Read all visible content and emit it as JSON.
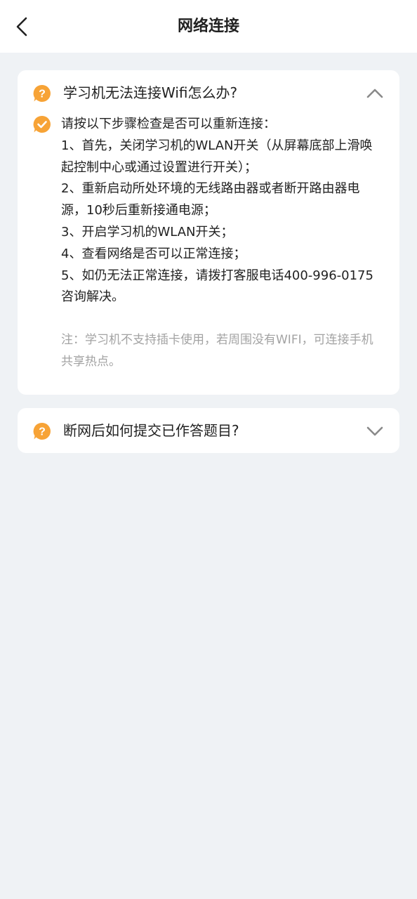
{
  "header": {
    "title": "网络连接"
  },
  "faq": [
    {
      "question": "学习机无法连接Wifi怎么办?",
      "expanded": true,
      "answer_lines": [
        "请按以下步骤检查是否可以重新连接：",
        "1、首先，关闭学习机的WLAN开关（从屏幕底部上滑唤起控制中心或通过设置进行开关）；",
        "2、重新启动所处环境的无线路由器或者断开路由器电源，10秒后重新接通电源；",
        "3、开启学习机的WLAN开关；",
        "4、查看网络是否可以正常连接；",
        "5、如仍无法正常连接，请拨打客服电话400-996-0175咨询解决。"
      ],
      "note": "注：学习机不支持插卡使用，若周围没有WIFI，可连接手机共享热点。"
    },
    {
      "question": "断网后如何提交已作答题目?",
      "expanded": false
    }
  ],
  "colors": {
    "accent": "#f7a336",
    "background": "#eff2f5",
    "card": "#ffffff",
    "note_text": "#a3a3a3",
    "chevron": "#8a8a8a"
  },
  "icons": {
    "back": "back-arrow-icon",
    "question": "question-bubble-icon",
    "answer": "check-bubble-icon",
    "collapse": "chevron-up-icon",
    "expand": "chevron-down-icon"
  }
}
